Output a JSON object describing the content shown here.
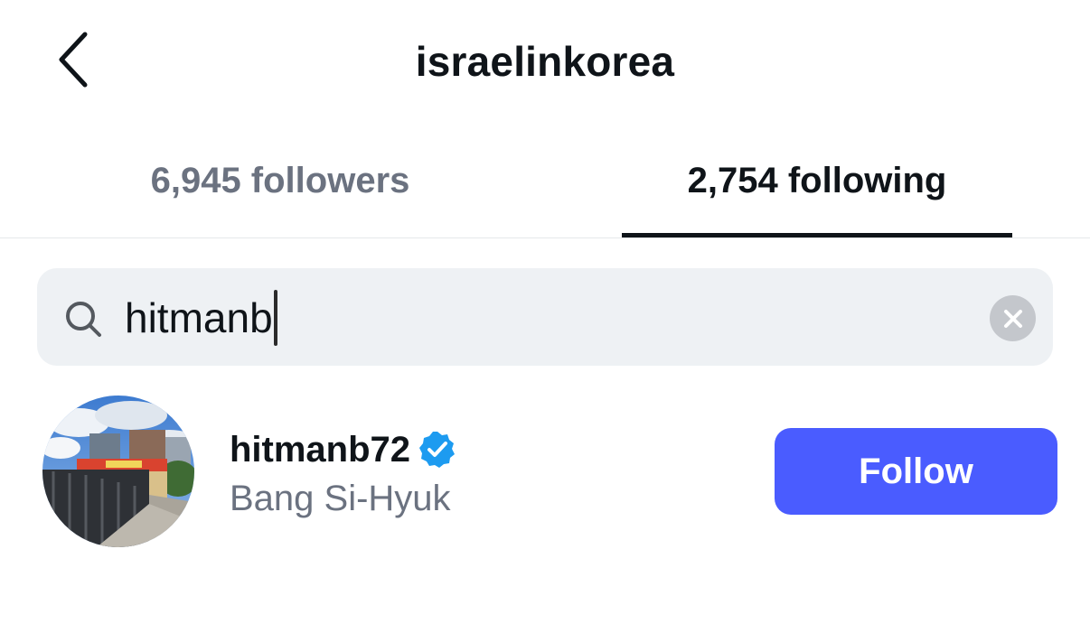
{
  "header": {
    "title": "israelinkorea",
    "back_icon": "chevron-left-icon"
  },
  "tabs": [
    {
      "label": "6,945 followers",
      "active": false
    },
    {
      "label": "2,754 following",
      "active": true
    }
  ],
  "search": {
    "value": "hitmanb",
    "icon": "search-icon",
    "clear_icon": "clear-icon"
  },
  "results": [
    {
      "username": "hitmanb72",
      "full_name": "Bang Si-Hyuk",
      "verified": true,
      "button_label": "Follow"
    }
  ],
  "colors": {
    "text_primary": "#0f1419",
    "text_secondary": "#6b7280",
    "search_bg": "#eef1f4",
    "follow_button": "#4a5cff",
    "verified_badge": "#1d9bf0"
  }
}
